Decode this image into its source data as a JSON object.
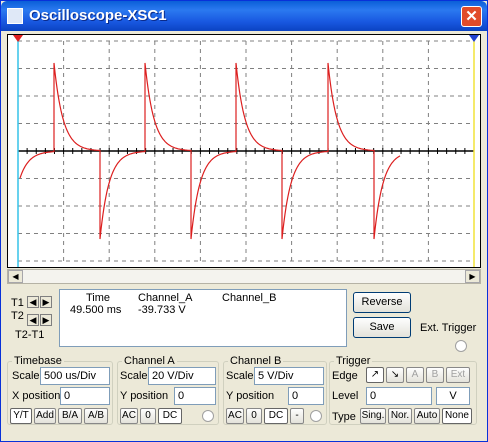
{
  "window": {
    "title": "Oscilloscope-XSC1",
    "close_glyph": "✕"
  },
  "colors": {
    "trace_a": "#dc1f1f",
    "cursor1": "#36c3e8",
    "cursor2": "#f2e43a",
    "grid": "#808080",
    "titlebar": "#1857e0"
  },
  "cursors": {
    "t1": "T1",
    "t2": "T2",
    "t2_t1": "T2-T1"
  },
  "readout": {
    "headers": {
      "time": "Time",
      "channel_a": "Channel_A",
      "channel_b": "Channel_B"
    },
    "row": {
      "time": "49.500 ms",
      "channel_a": "-39.733 V",
      "channel_b": ""
    }
  },
  "buttons": {
    "reverse": "Reverse",
    "save": "Save",
    "ext_trigger": "Ext. Trigger"
  },
  "timebase": {
    "label": "Timebase",
    "scale_label": "Scale",
    "scale": "500 us/Div",
    "xpos_label": "X position",
    "xpos": "0",
    "modes": [
      "Y/T",
      "Add",
      "B/A",
      "A/B"
    ]
  },
  "channel_a": {
    "label": "Channel A",
    "scale_label": "Scale",
    "scale": "20  V/Div",
    "ypos_label": "Y position",
    "ypos": "0",
    "coupling": [
      "AC",
      "0",
      "DC"
    ]
  },
  "channel_b": {
    "label": "Channel B",
    "scale_label": "Scale",
    "scale": "5  V/Div",
    "ypos_label": "Y position",
    "ypos": "0",
    "coupling": [
      "AC",
      "0",
      "DC",
      "-"
    ]
  },
  "trigger": {
    "label": "Trigger",
    "edge_label": "Edge",
    "level_label": "Level",
    "level": "0",
    "level_unit": "V",
    "type_label": "Type",
    "edge_buttons": [
      "↗",
      "↘",
      "A",
      "B",
      "Ext"
    ],
    "types": [
      "Sing.",
      "Nor.",
      "Auto",
      "None"
    ]
  }
}
